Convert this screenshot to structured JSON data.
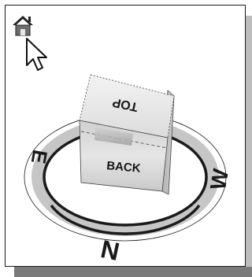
{
  "viewcube": {
    "home_icon": "home-icon",
    "cursor_icon": "arrow-cursor-icon",
    "faces": {
      "top": "TOP",
      "front": "BACK"
    },
    "compass": {
      "north": "N",
      "east": "E",
      "west": "W"
    }
  },
  "colors": {
    "ring": "#c6c6c6",
    "ring_outline": "#1a1a1a",
    "cube_top": "#e9e9e9",
    "cube_front": "#d8d8d8",
    "cube_side": "#b9b9b9",
    "text": "#151515"
  }
}
